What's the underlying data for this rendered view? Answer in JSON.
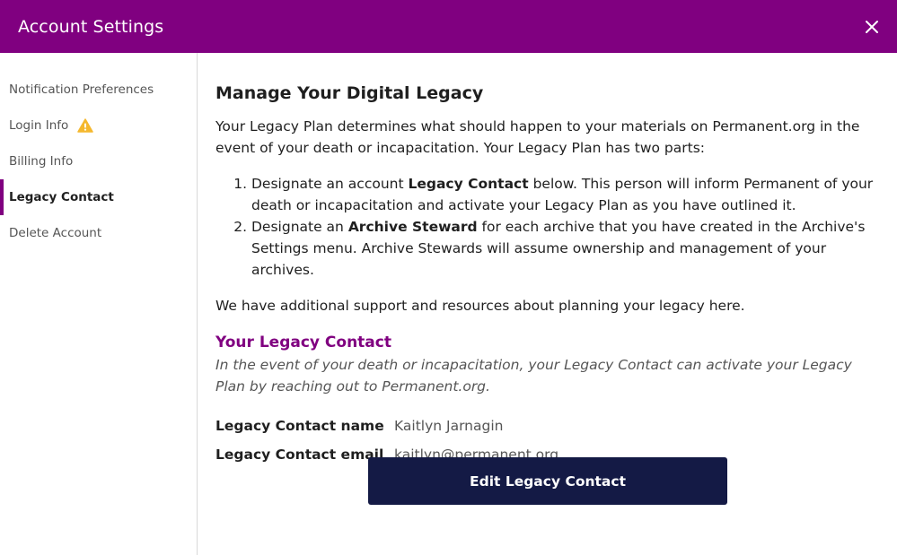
{
  "header": {
    "title": "Account Settings",
    "close_icon": "close-icon",
    "background_color": "#800080"
  },
  "sidebar": {
    "items": [
      {
        "label": "Notification Preferences",
        "active": false
      },
      {
        "label": "Login Info",
        "active": false,
        "icon": "warning-icon",
        "icon_color": "#f5b82e"
      },
      {
        "label": "Billing Info",
        "active": false
      },
      {
        "label": "Legacy Contact",
        "active": true
      },
      {
        "label": "Delete Account",
        "active": false
      }
    ]
  },
  "main": {
    "title": "Manage Your Digital Legacy",
    "intro": "Your Legacy Plan determines what should happen to your materials on Permanent.org in the event of your death or incapacitation. Your Legacy Plan has two parts:",
    "steps": [
      {
        "before": "Designate an account ",
        "bold": "Legacy Contact",
        "after": " below. This person will inform Permanent of your death or incapacitation and activate your Legacy Plan as you have outlined it."
      },
      {
        "before": "Designate an ",
        "bold": "Archive Steward",
        "after": " for each archive that you have created in the Archive's Settings menu. Archive Stewards will assume ownership and management of your archives."
      }
    ],
    "support_text": "We have additional support and resources about planning your legacy here.",
    "contact_section": {
      "title": "Your Legacy Contact",
      "description": "In the event of your death or incapacitation, your Legacy Contact can activate your Legacy Plan by reaching out to Permanent.org.",
      "name_label": "Legacy Contact name",
      "name_value": "Kaitlyn Jarnagin",
      "email_label": "Legacy Contact email",
      "email_value": "kaitlyn@permanent.org"
    },
    "edit_button_label": "Edit Legacy Contact",
    "button_color": "#141a45"
  }
}
